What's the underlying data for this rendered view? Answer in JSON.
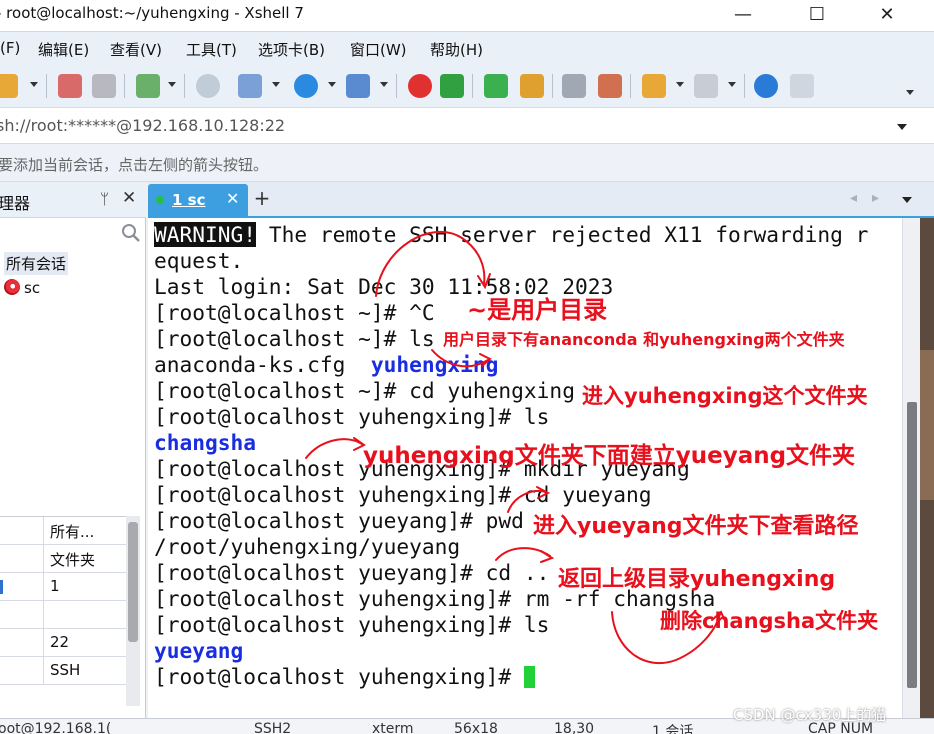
{
  "window": {
    "title": "- root@localhost:~/yuhengxing - Xshell 7",
    "minimize": "—",
    "maximize": "☐",
    "close": "✕"
  },
  "menu": [
    "(F)",
    "编辑(E)",
    "查看(V)",
    "工具(T)",
    "选项卡(B)",
    "窗口(W)",
    "帮助(H)"
  ],
  "address": "sh://root:******@192.168.10.128:22",
  "hint": "要添加当前会话，点击左侧的箭头按钮。",
  "session_manager": {
    "title": "理器",
    "pin": "ᛘ",
    "close": "✕",
    "tree_root": "所有会话",
    "tree_session": "sc",
    "props": [
      "所有...",
      "文件夹",
      "1",
      "",
      "22",
      "SSH"
    ]
  },
  "tabs": [
    {
      "label": "1 sc",
      "close": "✕"
    }
  ],
  "tab_add": "+",
  "terminal": {
    "warning_tag": "WARNING!",
    "lines": [
      " The remote SSH server rejected X11 forwarding r",
      "equest.",
      "Last login: Sat Dec 30 11:58:02 2023",
      "[root@localhost ~]# ^C",
      "[root@localhost ~]# ls",
      "anaconda-ks.cfg  ",
      "[root@localhost ~]# cd yuhengxing",
      "[root@localhost yuhengxing]# ls",
      "",
      "[root@localhost yuhengxing]# mkdir yueyang",
      "[root@localhost yuhengxing]# cd yueyang",
      "[root@localhost yueyang]# pwd",
      "/root/yuhengxing/yueyang",
      "[root@localhost yueyang]# cd ..",
      "[root@localhost yuhengxing]# rm -rf changsha",
      "[root@localhost yuhengxing]# ls",
      "",
      "[root@localhost yuhengxing]# "
    ],
    "dir_yuhengxing": "yuhengxing",
    "dir_changsha": "changsha",
    "dir_yueyang": "yueyang"
  },
  "annotations": {
    "home_dir": "~是用户目录",
    "ls_home": "用户目录下有ananconda 和yuhengxing两个文件夹",
    "cd_yuhengxing": "进入yuhengxing这个文件夹",
    "mkdir_note": "yuhengxing文件夹下面建立yueyang文件夹",
    "pwd_note": "进入yueyang文件夹下查看路径",
    "cd_up": "返回上级目录yuhengxing",
    "rm_note": "删除changsha文件夹",
    "color": "#e8101c"
  },
  "status": {
    "connection": "oot@192.168.1(",
    "protocol": "SSH2",
    "term": "xterm",
    "size": "56x18",
    "pos": "18,30",
    "sessions": "1 会话",
    "caps": "CAP NUM"
  },
  "watermark": "CSDN @cx330上的猫"
}
